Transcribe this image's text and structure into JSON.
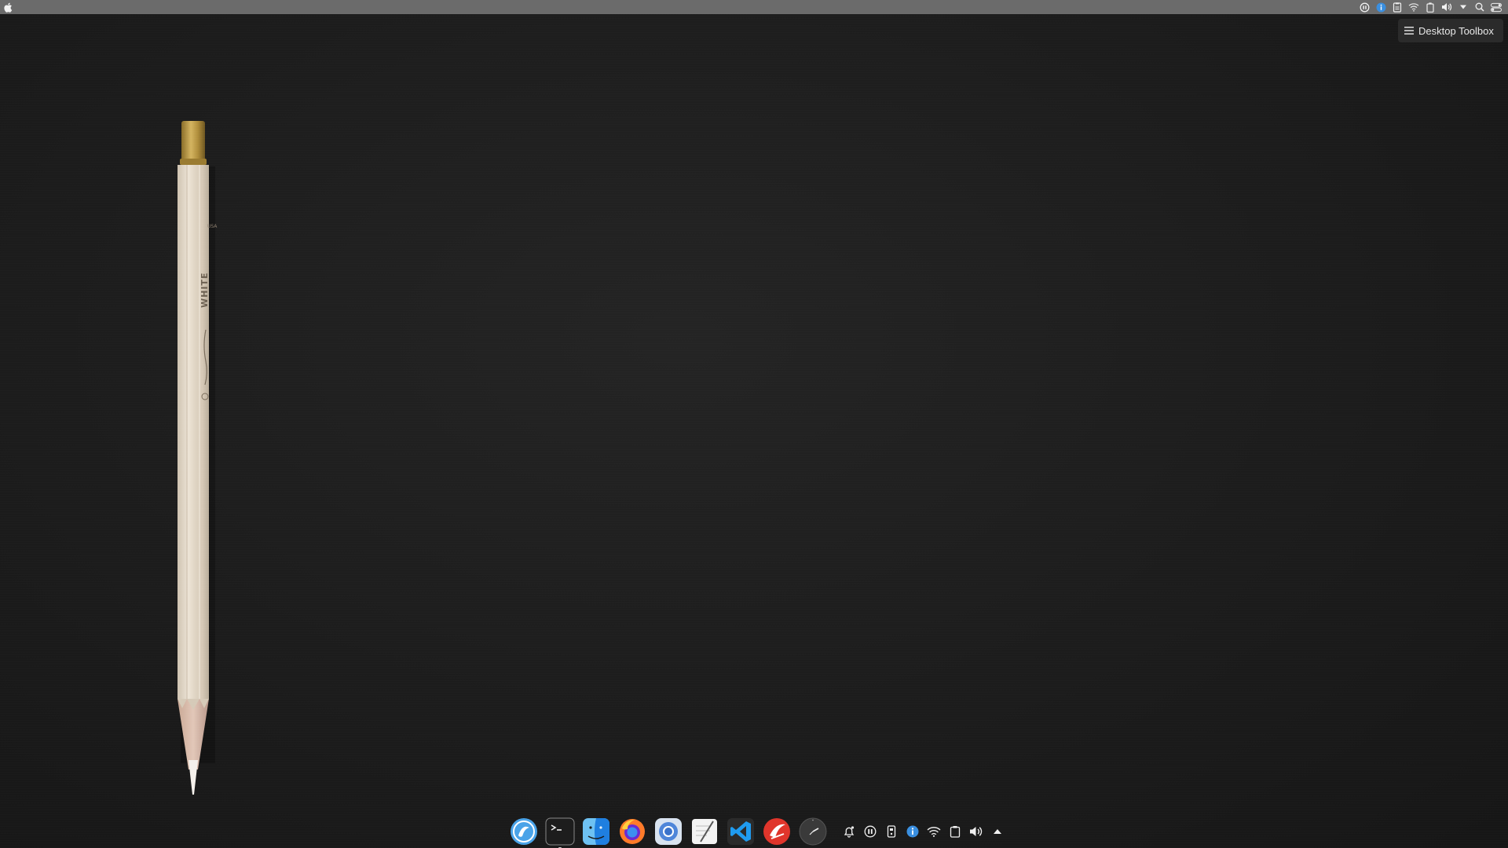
{
  "wallpaper": {
    "description_colors": {
      "background": "#1c1c1c",
      "pencil_body": "#e4d9c9",
      "pencil_ferrule": "#b8973e"
    },
    "pencil_imprint": {
      "brand_text": "USA",
      "color_text": "WHITE"
    }
  },
  "topbar": {
    "apple_icon": "apple-icon",
    "tray_icons": [
      "record-icon",
      "info-icon",
      "clipboard-doc-icon",
      "wifi-icon",
      "battery-icon",
      "volume-icon",
      "dropdown-icon",
      "search-icon",
      "control-center-icon"
    ]
  },
  "toolbox": {
    "label": "Desktop Toolbox",
    "icon": "hamburger-icon"
  },
  "dock": {
    "apps": [
      {
        "name": "elementary-browser",
        "icon": "browser-icon"
      },
      {
        "name": "terminal",
        "icon": "terminal-icon"
      },
      {
        "name": "finder",
        "icon": "finder-icon"
      },
      {
        "name": "firefox",
        "icon": "firefox-icon"
      },
      {
        "name": "chrome",
        "icon": "chrome-icon"
      },
      {
        "name": "text-editor",
        "icon": "text-editor-icon"
      },
      {
        "name": "vscode",
        "icon": "vscode-icon"
      },
      {
        "name": "app-red",
        "icon": "app-red-icon"
      },
      {
        "name": "clock",
        "icon": "clock-icon"
      }
    ],
    "tray_icons": [
      "bell-icon",
      "pause-icon",
      "phone-icon",
      "info-icon",
      "wifi-icon",
      "clipboard-icon",
      "volume-icon",
      "arrow-up-icon"
    ]
  }
}
